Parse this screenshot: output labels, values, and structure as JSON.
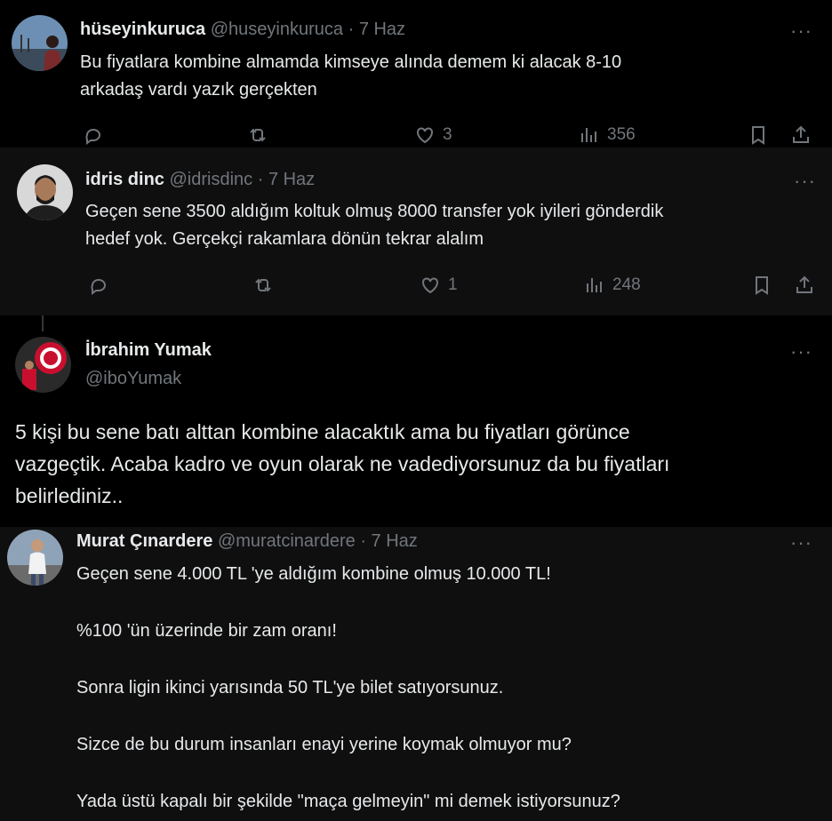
{
  "tweets": [
    {
      "name": "hüseyinkuruca",
      "handle": "@huseyinkuruca",
      "date": "7 Haz",
      "lines": [
        "Bu fiyatlara kombine almamda kimseye alında demem ki alacak 8-10",
        "arkadaş vardı yazık gerçekten"
      ],
      "likes": "3",
      "views": "356"
    },
    {
      "name": "idris dinc",
      "handle": "@idrisdinc",
      "date": "7 Haz",
      "lines": [
        "Geçen sene 3500 aldığım koltuk olmuş 8000 transfer yok iyileri gönderdik",
        "hedef yok. Gerçekçi rakamlara dönün tekrar alalım"
      ],
      "likes": "1",
      "views": "248"
    },
    {
      "name": "İbrahim Yumak",
      "handle": "@iboYumak",
      "lines": [
        "5 kişi bu sene batı alttan kombine alacaktık ama bu fiyatları görünce",
        "vazgeçtik. Acaba kadro ve oyun olarak ne vadediyorsunuz da bu fiyatları",
        "belirlediniz.."
      ]
    },
    {
      "name": "Murat Çınardere",
      "handle": "@muratcinardere",
      "date": "7 Haz",
      "paragraphs": [
        "Geçen sene 4.000 TL 'ye aldığım kombine olmuş 10.000 TL!",
        "%100 'ün üzerinde bir zam oranı!",
        "Sonra ligin ikinci yarısında 50 TL'ye bilet satıyorsunuz.",
        "Sizce de bu durum insanları enayi yerine koymak olmuyor mu?",
        "Yada üstü kapalı bir şekilde \"maça gelmeyin\" mi demek istiyorsunuz?"
      ]
    }
  ],
  "separator": "·",
  "more_glyph": "···",
  "colors": {
    "text": "#e7e9ea",
    "muted": "#71767b",
    "bg": "#000000",
    "bg_alt": "#0f0f10"
  },
  "icons": [
    "reply-icon",
    "retweet-icon",
    "like-icon",
    "views-icon",
    "bookmark-icon",
    "share-icon",
    "more-icon"
  ]
}
